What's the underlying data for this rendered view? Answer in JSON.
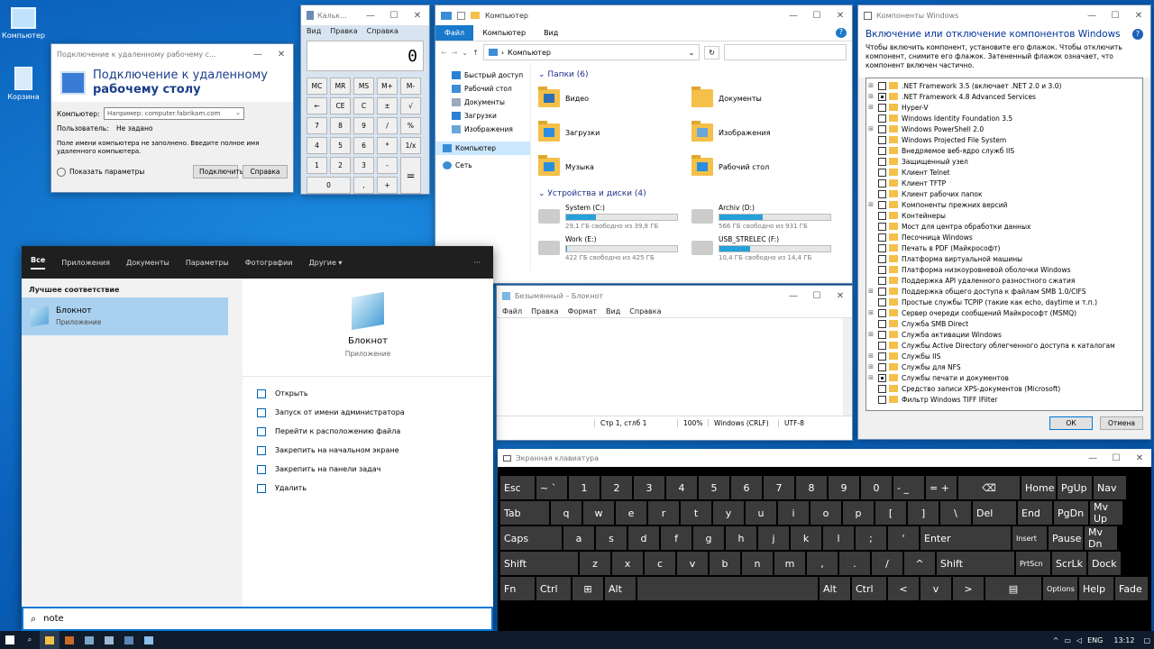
{
  "desktop": {
    "icons": [
      {
        "label": "Компьютер"
      },
      {
        "label": "Корзина"
      }
    ]
  },
  "rdp": {
    "window_title": "Подключение к удаленному рабочему с...",
    "header_line1": "Подключение к удаленному",
    "header_line2": "рабочему столу",
    "computer_label": "Компьютер:",
    "computer_placeholder": "Например: computer.fabrikam.com",
    "user_label": "Пользователь:",
    "user_value": "Не задано",
    "hint": "Поле имени компьютера не заполнено. Введите полное имя удаленного компьютера.",
    "show_options": "Показать параметры",
    "connect": "Подключить",
    "help": "Справка"
  },
  "calc": {
    "window_title": "Кальк...",
    "menu": [
      "Вид",
      "Правка",
      "Справка"
    ],
    "display": "0",
    "keys": [
      "MC",
      "MR",
      "MS",
      "M+",
      "M-",
      "←",
      "CE",
      "C",
      "±",
      "√",
      "7",
      "8",
      "9",
      "/",
      "%",
      "4",
      "5",
      "6",
      "*",
      "1/x",
      "1",
      "2",
      "3",
      "-",
      "=",
      "0",
      ",",
      "+"
    ]
  },
  "explorer": {
    "window_title": "Компьютер",
    "ribbon": [
      "Файл",
      "Компьютер",
      "Вид"
    ],
    "address": "Компьютер",
    "nav": [
      "Быстрый доступ",
      "Рабочий стол",
      "Документы",
      "Загрузки",
      "Изображения",
      "Компьютер",
      "Сеть"
    ],
    "folders_header": "Папки (6)",
    "folders": [
      "Видео",
      "Документы",
      "Загрузки",
      "Изображения",
      "Музыка",
      "Рабочий стол"
    ],
    "drives_header": "Устройства и диски (4)",
    "drives": [
      {
        "name": "System (C:)",
        "free": "29,1 ГБ свободно из 39,8 ГБ",
        "used_pct": 27
      },
      {
        "name": "Archiv (D:)",
        "free": "566 ГБ свободно из 931 ГБ",
        "used_pct": 39
      },
      {
        "name": "Work (E:)",
        "free": "422 ГБ свободно из 425 ГБ",
        "used_pct": 1
      },
      {
        "name": "USB_STRELEC (F:)",
        "free": "10,4 ГБ свободно из 14,4 ГБ",
        "used_pct": 28
      }
    ]
  },
  "features": {
    "window_title": "Компоненты Windows",
    "heading": "Включение или отключение компонентов Windows",
    "description": "Чтобы включить компонент, установите его флажок. Чтобы отключить компонент, снимите его флажок. Затененный флажок означает, что компонент включен частично.",
    "items": [
      {
        "label": ".NET Framework 3.5 (включает .NET 2.0 и 3.0)",
        "exp": true,
        "state": "off"
      },
      {
        "label": ".NET Framework 4.8 Advanced Services",
        "exp": true,
        "state": "part"
      },
      {
        "label": "Hyper-V",
        "exp": true,
        "state": "off"
      },
      {
        "label": "Windows Identity Foundation 3.5",
        "exp": false,
        "state": "off"
      },
      {
        "label": "Windows PowerShell 2.0",
        "exp": true,
        "state": "off"
      },
      {
        "label": "Windows Projected File System",
        "exp": false,
        "state": "off"
      },
      {
        "label": "Внедряемое веб-ядро служб IIS",
        "exp": false,
        "state": "off"
      },
      {
        "label": "Защищенный узел",
        "exp": false,
        "state": "off"
      },
      {
        "label": "Клиент Telnet",
        "exp": false,
        "state": "off"
      },
      {
        "label": "Клиент TFTP",
        "exp": false,
        "state": "off"
      },
      {
        "label": "Клиент рабочих папок",
        "exp": false,
        "state": "off"
      },
      {
        "label": "Компоненты прежних версий",
        "exp": true,
        "state": "off"
      },
      {
        "label": "Контейнеры",
        "exp": false,
        "state": "off"
      },
      {
        "label": "Мост для центра обработки данных",
        "exp": false,
        "state": "off"
      },
      {
        "label": "Песочница Windows",
        "exp": false,
        "state": "off"
      },
      {
        "label": "Печать в PDF (Майкрософт)",
        "exp": false,
        "state": "off"
      },
      {
        "label": "Платформа виртуальной машины",
        "exp": false,
        "state": "off"
      },
      {
        "label": "Платформа низкоуровневой оболочки Windows",
        "exp": false,
        "state": "off"
      },
      {
        "label": "Поддержка API удаленного разностного сжатия",
        "exp": false,
        "state": "off"
      },
      {
        "label": "Поддержка общего доступа к файлам SMB 1.0/CIFS",
        "exp": true,
        "state": "off"
      },
      {
        "label": "Простые службы TCPIP (такие как echo, daytime и т.п.)",
        "exp": false,
        "state": "off"
      },
      {
        "label": "Сервер очереди сообщений Майкрософт (MSMQ)",
        "exp": true,
        "state": "off"
      },
      {
        "label": "Служба SMB Direct",
        "exp": false,
        "state": "off"
      },
      {
        "label": "Служба активации Windows",
        "exp": true,
        "state": "off"
      },
      {
        "label": "Службы Active Directory облегченного доступа к каталогам",
        "exp": false,
        "state": "off"
      },
      {
        "label": "Службы IIS",
        "exp": true,
        "state": "off"
      },
      {
        "label": "Службы для NFS",
        "exp": true,
        "state": "off"
      },
      {
        "label": "Службы печати и документов",
        "exp": true,
        "state": "part"
      },
      {
        "label": "Средство записи XPS-документов (Microsoft)",
        "exp": false,
        "state": "off"
      },
      {
        "label": "Фильтр Windows TIFF IFilter",
        "exp": false,
        "state": "off"
      }
    ],
    "ok": "ОК",
    "cancel": "Отмена"
  },
  "search": {
    "tabs": [
      "Все",
      "Приложения",
      "Документы",
      "Параметры",
      "Фотографии",
      "Другие ▾"
    ],
    "more": "···",
    "best_header": "Лучшее соответствие",
    "result_name": "Блокнот",
    "result_type": "Приложение",
    "actions": [
      "Открыть",
      "Запуск от имени администратора",
      "Перейти к расположению файла",
      "Закрепить на начальном экране",
      "Закрепить на панели задач",
      "Удалить"
    ],
    "query": "note"
  },
  "notepad": {
    "window_title": "Безымянный – Блокнот",
    "menu": [
      "Файл",
      "Правка",
      "Формат",
      "Вид",
      "Справка"
    ],
    "status": [
      "Стр 1, стлб 1",
      "100%",
      "Windows (CRLF)",
      "UTF-8"
    ]
  },
  "osk": {
    "window_title": "Экранная клавиатура",
    "rows": [
      [
        "Esc",
        "~ `",
        "1",
        "2",
        "3",
        "4",
        "5",
        "6",
        "7",
        "8",
        "9",
        "0",
        "- _",
        "= +",
        "⌫",
        "Home",
        "PgUp",
        "Nav"
      ],
      [
        "Tab",
        "q",
        "w",
        "e",
        "r",
        "t",
        "y",
        "u",
        "i",
        "o",
        "p",
        "[",
        "]",
        "\\",
        "Del",
        "End",
        "PgDn",
        "Mv Up"
      ],
      [
        "Caps",
        "a",
        "s",
        "d",
        "f",
        "g",
        "h",
        "j",
        "k",
        "l",
        ";",
        "'",
        "Enter",
        "Insert",
        "Pause",
        "Mv Dn"
      ],
      [
        "Shift",
        "z",
        "x",
        "c",
        "v",
        "b",
        "n",
        "m",
        ",",
        ".",
        "/",
        "^",
        "Shift",
        "PrtScn",
        "ScrLk",
        "Dock"
      ],
      [
        "Fn",
        "Ctrl",
        "⊞",
        "Alt",
        "",
        "Alt",
        "Ctrl",
        "<",
        "v",
        ">",
        "▤",
        "Options",
        "Help",
        "Fade"
      ]
    ]
  },
  "taskbar": {
    "lang": "ENG",
    "time": "13:12"
  }
}
